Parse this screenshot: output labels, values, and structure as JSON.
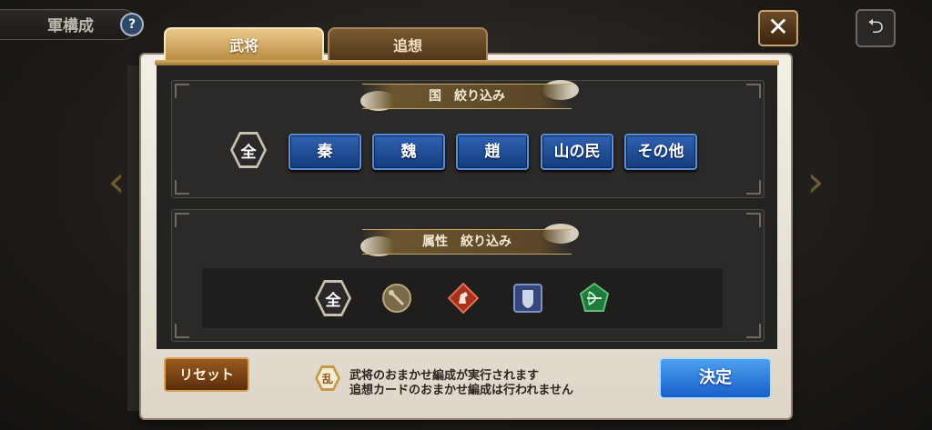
{
  "background": {
    "title": "軍構成",
    "help_label": "?",
    "back_label": "⮌"
  },
  "dialog": {
    "tabs": [
      {
        "label": "武将",
        "active": true
      },
      {
        "label": "追想",
        "active": false
      }
    ],
    "country_filter": {
      "heading": "国　絞り込み",
      "all_label": "全",
      "options": [
        "秦",
        "魏",
        "趙",
        "山の民",
        "その他"
      ]
    },
    "attribute_filter": {
      "heading": "属性　絞り込み",
      "all_label": "全",
      "icons": [
        "spear-icon",
        "cavalry-icon",
        "shield-icon",
        "bow-icon"
      ]
    },
    "reset_label": "リセット",
    "note_badge": "乱",
    "note_lines": [
      "武将のおまかせ編成が実行されます",
      "追想カードのおまかせ編成は行われません"
    ],
    "confirm_label": "決定",
    "close_label": "✕"
  },
  "colors": {
    "country_button": "#1f4f9a",
    "confirm_button": "#2a7ee0",
    "reset_button": "#7a4416",
    "tab_active": "#d4aa62"
  }
}
